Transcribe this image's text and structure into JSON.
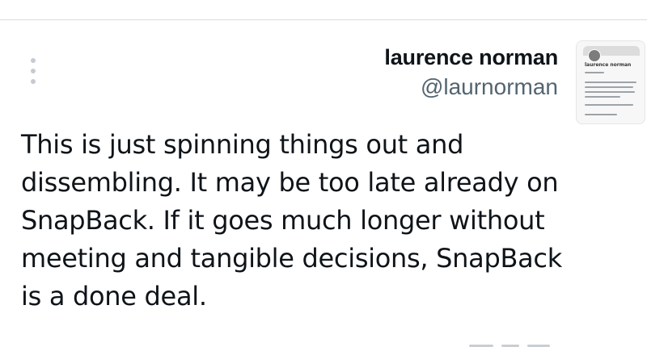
{
  "tweet": {
    "author": {
      "name": "laurence norman",
      "handle": "@laurnorman",
      "avatar_icon": "profile-card-thumbnail"
    },
    "text": "This is just spinning things out and\ndissembling. It may be too late already on\nSnapBack. If it goes much longer without\nmeeting and tangible decisions, SnapBack\nis a done deal.",
    "more_icon": "vertical-ellipsis-icon"
  },
  "colors": {
    "text": "#0f1419",
    "secondary": "#536471",
    "divider": "#d8dde1",
    "menu_dots": "#c6cbd0"
  }
}
